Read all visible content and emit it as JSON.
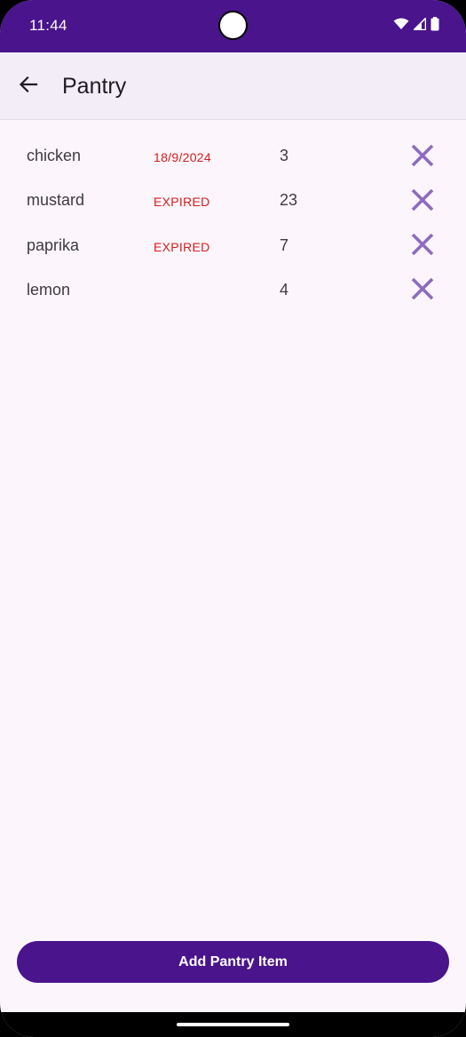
{
  "status_bar": {
    "time": "11:44",
    "icons": [
      "wifi-icon",
      "signal-icon",
      "battery-icon"
    ]
  },
  "app_bar": {
    "back_icon": "arrow-left-icon",
    "title": "Pantry"
  },
  "pantry_items": [
    {
      "name": "chicken",
      "expiry": "18/9/2024",
      "quantity": "3",
      "delete_icon": "close-icon"
    },
    {
      "name": "mustard",
      "expiry": "EXPIRED",
      "quantity": "23",
      "delete_icon": "close-icon"
    },
    {
      "name": "paprika",
      "expiry": "EXPIRED",
      "quantity": "7",
      "delete_icon": "close-icon"
    },
    {
      "name": "lemon",
      "expiry": "",
      "quantity": "4",
      "delete_icon": "close-icon"
    }
  ],
  "add_button": {
    "label": "Add Pantry Item"
  },
  "colors": {
    "primary": "#4a148c",
    "background": "#fcf6fc",
    "app_bar": "#f2edf6",
    "expiry_text": "#d81b1b",
    "delete_icon": "#8e6bbd"
  }
}
